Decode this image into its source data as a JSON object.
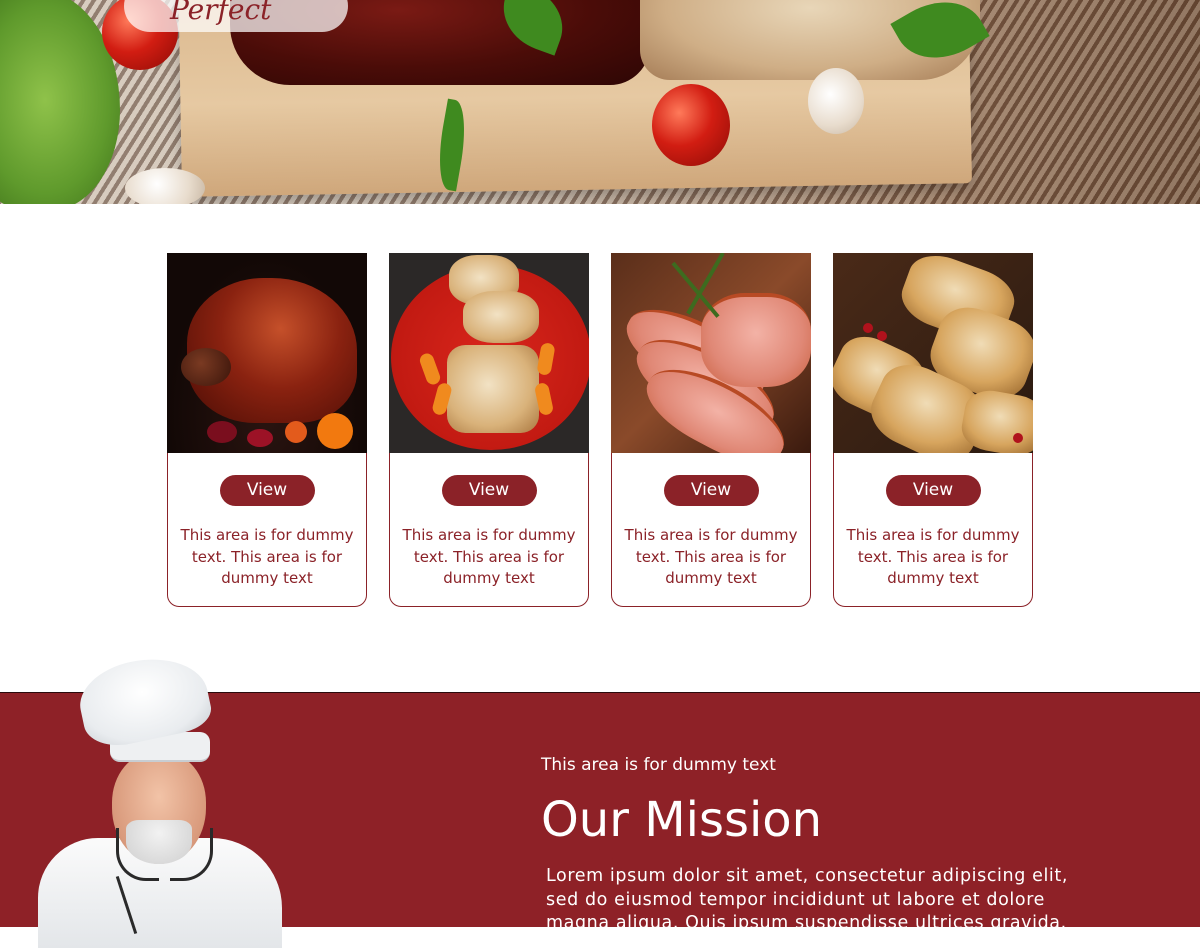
{
  "hero": {
    "badge_text": "Perfect"
  },
  "cards": [
    {
      "image": "glazed-ham-image",
      "button_label": "View",
      "text": "This area is for dummy text. This area is for dummy text"
    },
    {
      "image": "rolled-roast-image",
      "button_label": "View",
      "text": "This area is for dummy text. This area is for dummy text"
    },
    {
      "image": "sliced-ham-image",
      "button_label": "View",
      "text": "This area is for dummy text. This area is for dummy text"
    },
    {
      "image": "sliced-turkey-image",
      "button_label": "View",
      "text": "This area is for dummy text. This area is for dummy text"
    }
  ],
  "mission": {
    "kicker": "This area is for dummy text",
    "title": "Our Mission",
    "body": "Lorem ipsum dolor sit amet, consectetur adipiscing elit, sed do eiusmod tempor incididunt ut labore et dolore magna aliqua. Quis ipsum suspendisse ultrices gravida."
  },
  "colors": {
    "accent": "#8b2228",
    "mission_bg": "#8e2127",
    "white": "#ffffff"
  }
}
